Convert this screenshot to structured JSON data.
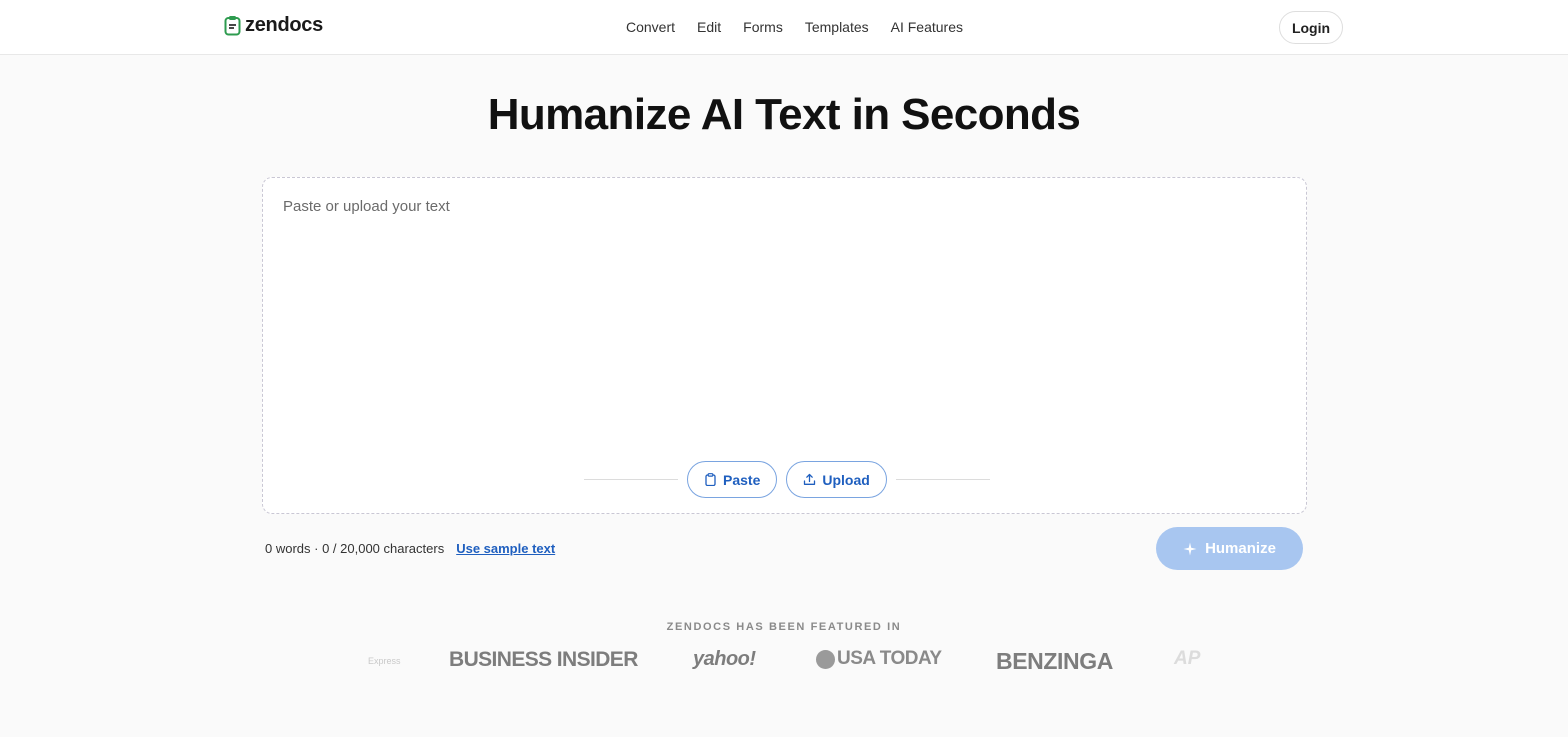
{
  "header": {
    "brand": "zendocs",
    "nav": [
      "Convert",
      "Edit",
      "Forms",
      "Templates",
      "AI Features"
    ],
    "login_label": "Login"
  },
  "hero": {
    "title": "Humanize AI Text in Seconds"
  },
  "editor": {
    "placeholder": "Paste or upload your text",
    "value": "",
    "paste_label": "Paste",
    "upload_label": "Upload"
  },
  "meta": {
    "counts": "0 words · 0 / 20,000 characters",
    "sample_link": "Use sample text"
  },
  "humanize_label": "Humanize",
  "featured": {
    "label": "ZENDOCS HAS BEEN FEATURED IN",
    "logos": [
      "Express",
      "BUSINESS INSIDER",
      "yahoo!",
      "USA TODAY",
      "BENZINGA",
      "AP"
    ]
  },
  "colors": {
    "accent": "#1f5fbf",
    "humanize_disabled": "#a8c6f0",
    "logo_green": "#2e9b4f"
  },
  "icons": {
    "logo": "document-icon",
    "paste": "clipboard-icon",
    "upload": "upload-icon",
    "humanize": "sparkle-icon"
  }
}
